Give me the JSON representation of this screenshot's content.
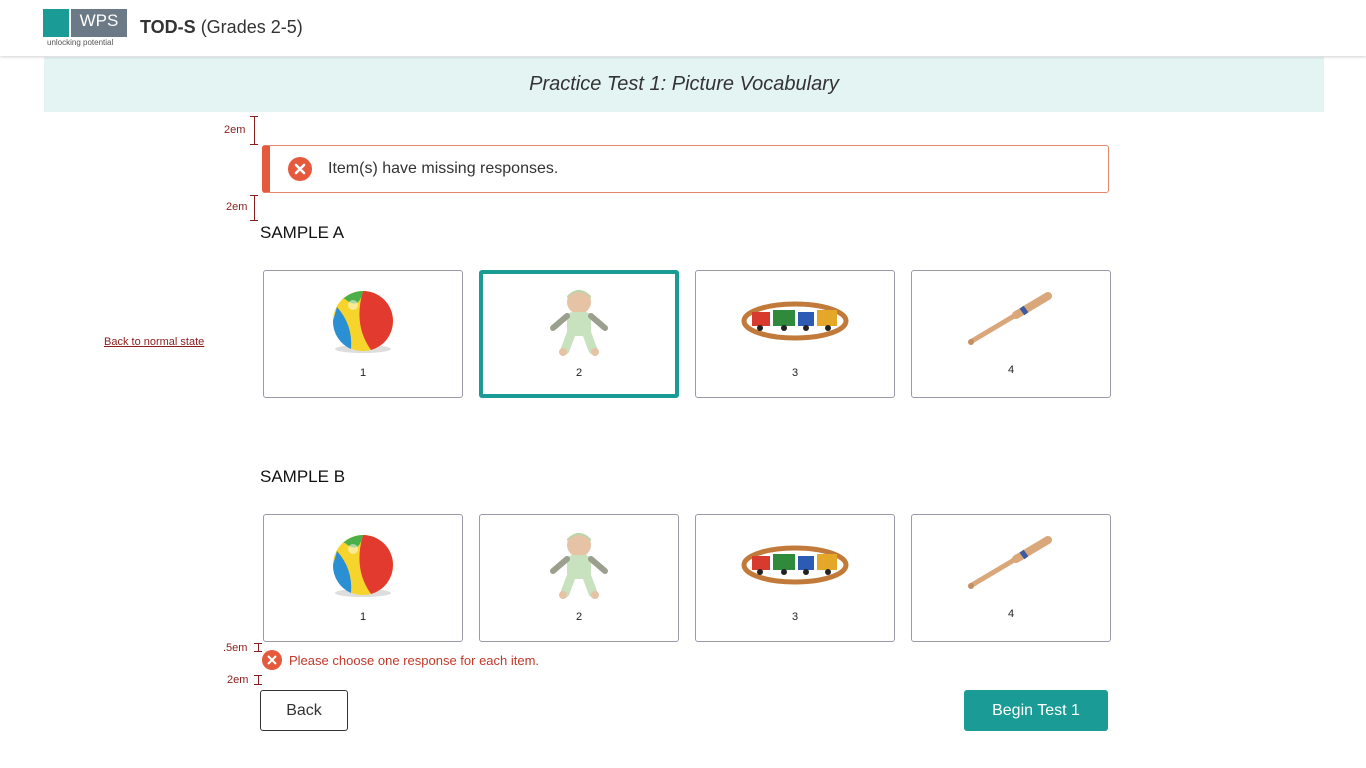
{
  "header": {
    "logo_text": "WPS",
    "logo_tagline": "unlocking potential",
    "test_name": "TOD-S",
    "grade_range": "(Grades 2-5)"
  },
  "banner": {
    "title": "Practice Test 1: Picture Vocabulary"
  },
  "annotations": {
    "top_gap": "2em",
    "bottom_gap": "2em",
    "inline_gap": ".5em",
    "button_gap": "2em",
    "back_to_normal": "Back to normal state"
  },
  "alert": {
    "message": "Item(s) have missing responses."
  },
  "samples": [
    {
      "label": "SAMPLE A",
      "choices": [
        {
          "number": "1",
          "picture": "beach-ball",
          "selected": false
        },
        {
          "number": "2",
          "picture": "baby-doll",
          "selected": true
        },
        {
          "number": "3",
          "picture": "toy-train",
          "selected": false
        },
        {
          "number": "4",
          "picture": "baseball-bat",
          "selected": false
        }
      ]
    },
    {
      "label": "SAMPLE B",
      "choices": [
        {
          "number": "1",
          "picture": "beach-ball",
          "selected": false
        },
        {
          "number": "2",
          "picture": "baby-doll",
          "selected": false
        },
        {
          "number": "3",
          "picture": "toy-train",
          "selected": false
        },
        {
          "number": "4",
          "picture": "baseball-bat",
          "selected": false
        }
      ]
    }
  ],
  "inline_error": {
    "message": "Please choose one response for each item."
  },
  "buttons": {
    "back": "Back",
    "begin": "Begin Test 1"
  },
  "colors": {
    "teal": "#1a9b95",
    "banner_bg": "#e3f4f3",
    "error": "#e55a3c",
    "annotation": "#8b1d1d"
  }
}
